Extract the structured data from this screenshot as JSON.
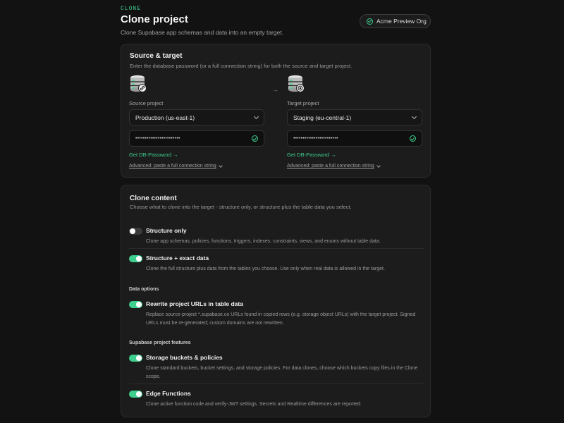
{
  "header": {
    "eyebrow": "CLONE",
    "title": "Clone project",
    "subtitle": "Clone Supabase app schemas and data into an empty target.",
    "org_label": "Acme Preview Org"
  },
  "source_target": {
    "title": "Source & target",
    "description": "Enter the database password (or a full connection string) for both the source and target project.",
    "arrow_icon": "arrow-right-icon",
    "source": {
      "label": "Source project",
      "selected": "Production (us-east-1)",
      "password_mask": "••••••••••••••••••••••••",
      "get_password_link": "Get DB-Password →",
      "advanced_link": "Advanced: paste a full connection string",
      "badge_icon": "link-icon"
    },
    "target": {
      "label": "Target project",
      "selected": "Staging (eu-central-1)",
      "password_mask": "••••••••••••••••••••••••",
      "get_password_link": "Get DB-Password →",
      "advanced_link": "Advanced: paste a full connection string",
      "badge_icon": "target-icon"
    }
  },
  "clone_content": {
    "title": "Clone content",
    "description": "Choose what to clone into the target - structure only, or structure plus the table data you select.",
    "options": [
      {
        "title": "Structure only",
        "description": "Clone app schemas, policies, functions, triggers, indexes, constraints, views, and enums without table data.",
        "enabled": false
      },
      {
        "title": "Structure + exact data",
        "description": "Clone the full structure plus data from the tables you choose. Use only when real data is allowed in the target.",
        "enabled": true
      }
    ],
    "data_options": {
      "label": "Data options",
      "items": [
        {
          "title": "Rewrite project URLs in table data",
          "description": "Replace source-project *.supabase.co URLs found in copied rows (e.g. storage object URLs) with the target project. Signed URLs must be re-generated; custom domains are not rewritten.",
          "enabled": true
        }
      ]
    },
    "features": {
      "label": "Supabase project features",
      "items": [
        {
          "title": "Storage buckets & policies",
          "description": "Clone standard buckets, bucket settings, and storage policies. For data clones, choose which buckets copy files in the Clone scope.",
          "enabled": true
        },
        {
          "title": "Edge Functions",
          "description": "Clone active function code and verify-JWT settings. Secrets and Realtime differences are reported.",
          "enabled": true
        }
      ]
    }
  },
  "colors": {
    "accent": "#3ecf8e",
    "background": "#121212",
    "card": "#1c1c1c"
  }
}
